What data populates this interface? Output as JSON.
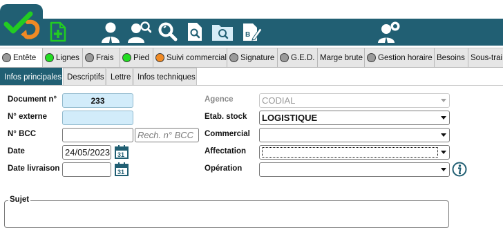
{
  "main_tabs": [
    {
      "label": "Entête",
      "status_color": "#9a9a9a",
      "active": true
    },
    {
      "label": "Lignes",
      "status_color": "#22dd22",
      "active": false
    },
    {
      "label": "Frais",
      "status_color": "#9a9a9a",
      "active": false
    },
    {
      "label": "Pied",
      "status_color": "#22dd22",
      "active": false
    },
    {
      "label": "Suivi commercial",
      "status_color": "#f08a24",
      "active": false
    },
    {
      "label": "Signature",
      "status_color": "#9a9a9a",
      "active": false
    },
    {
      "label": "G.E.D.",
      "status_color": "#9a9a9a",
      "active": false
    },
    {
      "label": "Marge brute",
      "status_color": null,
      "active": false
    },
    {
      "label": "Gestion horaire",
      "status_color": "#9a9a9a",
      "active": false
    },
    {
      "label": "Besoins",
      "status_color": null,
      "active": false
    },
    {
      "label": "Sous-trai",
      "status_color": null,
      "active": false
    }
  ],
  "sub_tabs": [
    {
      "label": "Infos principales",
      "active": true
    },
    {
      "label": "Descriptifs",
      "active": false
    },
    {
      "label": "Lettre",
      "active": false
    },
    {
      "label": "Infos techniques",
      "active": false
    }
  ],
  "form": {
    "document_label": "Document n°",
    "document_value": "233",
    "external_label": "N° externe",
    "external_value": "",
    "bcc_label": "N° BCC",
    "bcc_value": "",
    "bcc_search_placeholder": "Rech. n° BCC",
    "date_label": "Date",
    "date_value": "24/05/2023",
    "delivery_label": "Date livraison",
    "delivery_value": "",
    "calendar_day": "31",
    "agency_label": "Agence",
    "agency_value": "CODIAL",
    "stock_label": "Etab. stock",
    "stock_value": "LOGISTIQUE",
    "commercial_label": "Commercial",
    "commercial_value": "",
    "affectation_label": "Affectation",
    "affectation_value": "",
    "operation_label": "Opération",
    "operation_value": "",
    "subject_label": "Sujet"
  },
  "colors": {
    "toolbar": "#215f73",
    "accent_green": "#22c522",
    "accent_orange": "#f08a24"
  },
  "toolbar_icons": [
    "logo-check-icon",
    "new-document-icon",
    "user-icon",
    "user-search-icon",
    "search-icon",
    "document-search-icon",
    "folder-search-icon",
    "document-edit-icon",
    "user-settings-icon"
  ]
}
